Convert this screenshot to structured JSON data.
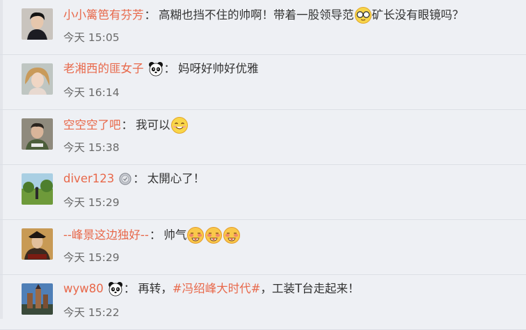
{
  "comments": [
    {
      "avatar_icon": "avatar-young-man-icon",
      "name": "小小篱笆有芬芳",
      "text": "高糊也挡不住的帅啊！带着一股领导范",
      "emoji_icon": "glasses-face-emoji-icon",
      "text_after": "矿长没有眼镜吗？",
      "time": "今天 15:05"
    },
    {
      "avatar_icon": "avatar-blonde-woman-icon",
      "name": "老湘西的匪女子",
      "badge_icon": "panda-icon",
      "text": "妈呀好帅好优雅",
      "time": "今天 16:14"
    },
    {
      "avatar_icon": "avatar-boy-icon",
      "name": "空空空了吧",
      "text": "我可以",
      "emoji_icon": "smiling-face-emoji-icon",
      "time": "今天 15:38"
    },
    {
      "avatar_icon": "avatar-landscape-icon",
      "name": "diver123",
      "badge_icon": "medal-icon",
      "text": "太開心了！",
      "time": "今天 15:29"
    },
    {
      "avatar_icon": "avatar-costume-icon",
      "name": "--峰景这边独好--",
      "text": "帅气",
      "emoji_icon": "flushed-face-emoji-icon",
      "emoji_count": 3,
      "time": "今天 15:29"
    },
    {
      "avatar_icon": "avatar-castle-icon",
      "name": "wyw80",
      "badge_icon": "panda-icon",
      "text": "再转，",
      "hashtag": "#冯绍峰大时代#",
      "text_after": "，工装T台走起来！",
      "time": "今天 15:22"
    }
  ],
  "colors": {
    "username": "#e8684a",
    "text": "#333333",
    "time": "#6a6a6a",
    "background": "#eef0f4"
  }
}
